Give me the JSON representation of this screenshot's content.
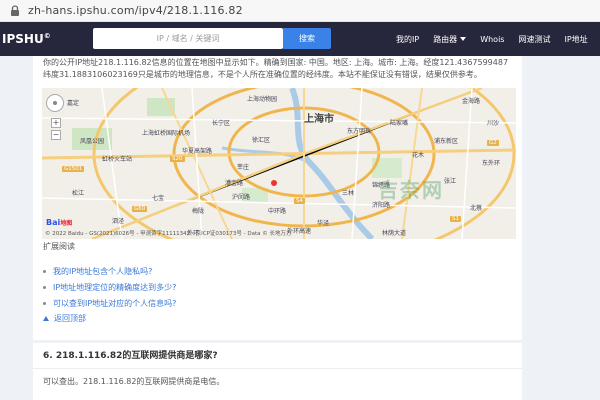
{
  "browser": {
    "url": "zh-hans.ipshu.com/ipv4/218.1.116.82"
  },
  "nav": {
    "logo": "IPSHU",
    "logo_mark": "©",
    "search_placeholder": "IP / 域名 / 关键词",
    "search_button": "搜索",
    "menu": [
      "我的IP",
      "路由器",
      "Whois",
      "网速测试",
      "IP地址"
    ]
  },
  "main": {
    "description": "你的公开IP地址218.1.116.82信息的位置在地图中显示如下。精确到国家: 中国。地区: 上海。城市: 上海。经度121.4367599487纬度31.1883106023169只是城市的地理信息，不是个人所在准确位置的经纬度。本站不能保证没有错误，结果仅供参考。",
    "map": {
      "city_label": "上海市",
      "labels": [
        "上海动物园",
        "上海虹桥国际机场",
        "凤凰公园",
        "虹桥火车站",
        "莘庄",
        "漕宝路",
        "中环路",
        "外环高速",
        "徐汇区",
        "东方明珠",
        "陆家嘴",
        "张江",
        "花木",
        "北蔡",
        "华泾",
        "梅陇",
        "七宝",
        "嘉定",
        "泗泾",
        "川沙",
        "华夏高架路",
        "沪闵路",
        "济阳路",
        "长宁区",
        "浦东新区",
        "东外环",
        "金海路",
        "锦绣路",
        "林荫大道",
        "松江",
        "外环",
        "三林"
      ],
      "highways": [
        "S20",
        "G60",
        "S4",
        "G2",
        "S1",
        "G1501"
      ],
      "brand": "Bai",
      "brand_suffix": "地图",
      "credit": "© 2022 Baidu - GS(2021)6026号 - 甲测资字11111342 - 京ICP证030173号 - Data © 长地万方"
    },
    "ext_title": "扩展阅读",
    "ext_links": [
      "我的IP地址包含个人隐私吗?",
      "IP地址地理定位的精确度达到多少?",
      "可以查到IP地址对应的个人信息吗?"
    ],
    "back_top": "返回顶部"
  },
  "section6": {
    "heading": "6. 218.1.116.82的互联网提供商是哪家?",
    "answer": "可以查出。218.1.116.82的互联网提供商是电信。"
  },
  "watermark": "吉奈网"
}
